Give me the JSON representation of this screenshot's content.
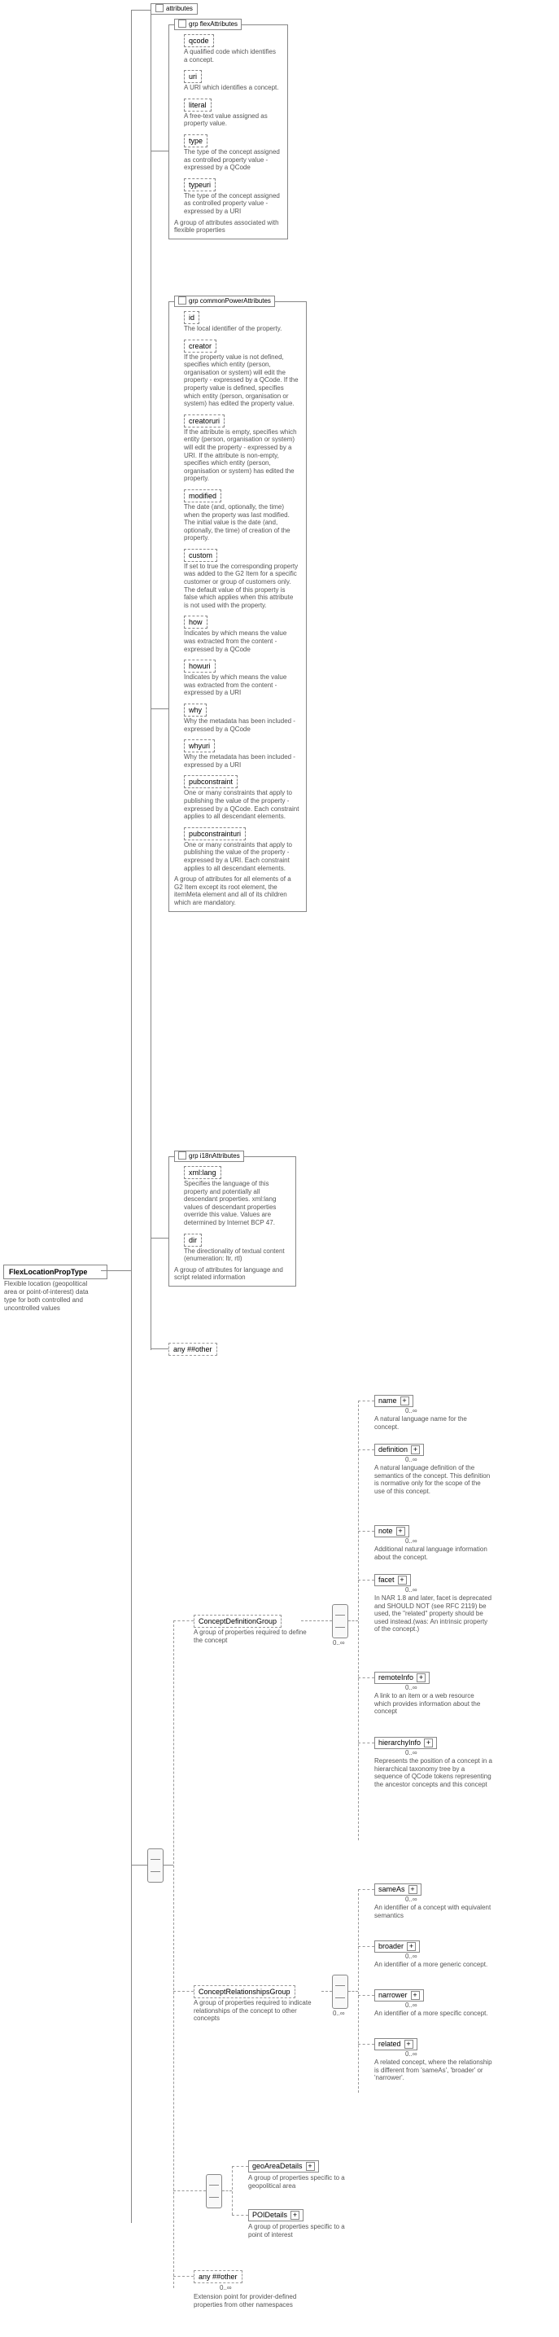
{
  "root": {
    "title": "FlexLocationPropType",
    "desc": "Flexible location (geopolitical area or point-of-interest) data type for both controlled and uncontrolled values"
  },
  "attributesHeader": "attributes",
  "groups": {
    "flex": {
      "header": "grp  flexAttributes",
      "desc": "A group of attributes associated with flexible properties",
      "items": [
        {
          "n": "qcode",
          "d": "A qualified code which identifies a concept."
        },
        {
          "n": "uri",
          "d": "A URI which identifies a concept."
        },
        {
          "n": "literal",
          "d": "A free-text value assigned as property value."
        },
        {
          "n": "type",
          "d": "The type of the concept assigned as controlled property value - expressed by a QCode"
        },
        {
          "n": "typeuri",
          "d": "The type of the concept assigned as controlled property value - expressed by a URI"
        }
      ]
    },
    "common": {
      "header": "grp  commonPowerAttributes",
      "desc": "A group of attributes for all elements of a G2 Item except its root element, the itemMeta element and all of its children which are mandatory.",
      "items": [
        {
          "n": "id",
          "d": "The local identifier of the property."
        },
        {
          "n": "creator",
          "d": "If the property value is not defined, specifies which entity (person, organisation or system) will edit the property - expressed by a QCode. If the property value is defined, specifies which entity (person, organisation or system) has edited the property value."
        },
        {
          "n": "creatoruri",
          "d": "If the attribute is empty, specifies which entity (person, organisation or system) will edit the property - expressed by a URI. If the attribute is non-empty, specifies which entity (person, organisation or system) has edited the property."
        },
        {
          "n": "modified",
          "d": "The date (and, optionally, the time) when the property was last modified. The initial value is the date (and, optionally, the time) of creation of the property."
        },
        {
          "n": "custom",
          "d": "If set to true the corresponding property was added to the G2 Item for a specific customer or group of customers only. The default value of this property is false which applies when this attribute is not used with the property."
        },
        {
          "n": "how",
          "d": "Indicates by which means the value was extracted from the content - expressed by a QCode"
        },
        {
          "n": "howuri",
          "d": "Indicates by which means the value was extracted from the content - expressed by a URI"
        },
        {
          "n": "why",
          "d": "Why the metadata has been included - expressed by a QCode"
        },
        {
          "n": "whyuri",
          "d": "Why the metadata has been included - expressed by a URI"
        },
        {
          "n": "pubconstraint",
          "d": "One or many constraints that apply to publishing the value of the property - expressed by a QCode. Each constraint applies to all descendant elements."
        },
        {
          "n": "pubconstrainturi",
          "d": "One or many constraints that apply to publishing the value of the property - expressed by a URI. Each constraint applies to all descendant elements."
        }
      ]
    },
    "i18n": {
      "header": "grp  i18nAttributes",
      "desc": "A group of attributes for language and script related information",
      "items": [
        {
          "n": "xml:lang",
          "d": "Specifies the language of this property and potentially all descendant properties. xml:lang values of descendant properties override this value. Values are determined by Internet BCP 47."
        },
        {
          "n": "dir",
          "d": "The directionality of textual content (enumeration: ltr, rtl)"
        }
      ]
    }
  },
  "anyOther1": "any  ##other",
  "conceptDef": {
    "title": "ConceptDefinitionGroup",
    "desc": "A group of properties required to define the concept",
    "leaves": [
      {
        "n": "name",
        "d": "A natural language name for the concept."
      },
      {
        "n": "definition",
        "d": "A natural language definition of the semantics of the concept. This definition is normative only for the scope of the use of this concept."
      },
      {
        "n": "note",
        "d": "Additional natural language information about the concept."
      },
      {
        "n": "facet",
        "d": "In NAR 1.8 and later, facet is deprecated and SHOULD NOT (see RFC 2119) be used, the \"related\" property should be used instead.(was: An intrinsic property of the concept.)"
      },
      {
        "n": "remoteInfo",
        "d": "A link to an item or a web resource which provides information about the concept"
      },
      {
        "n": "hierarchyInfo",
        "d": "Represents the position of a concept in a hierarchical taxonomy tree by a sequence of QCode tokens representing the ancestor concepts and this concept"
      }
    ]
  },
  "conceptRel": {
    "title": "ConceptRelationshipsGroup",
    "desc": "A group of properties required to indicate relationships of the concept to other concepts",
    "leaves": [
      {
        "n": "sameAs",
        "d": "An identifier of a concept with equivalent semantics"
      },
      {
        "n": "broader",
        "d": "An identifier of a more generic concept."
      },
      {
        "n": "narrower",
        "d": "An identifier of a more specific concept."
      },
      {
        "n": "related",
        "d": "A related concept, where the relationship is different from 'sameAs', 'broader' or 'narrower'."
      }
    ]
  },
  "choice": {
    "geo": {
      "n": "geoAreaDetails",
      "d": "A group of properties specific to a geopolitical area"
    },
    "poi": {
      "n": "POIDetails",
      "d": "A group of properties specific to a point of interest"
    }
  },
  "anyOther2": "any  ##other",
  "anyOther2desc": "Extension point for provider-defined properties from other namespaces",
  "occ": "0..∞",
  "grpLabel": "grp"
}
